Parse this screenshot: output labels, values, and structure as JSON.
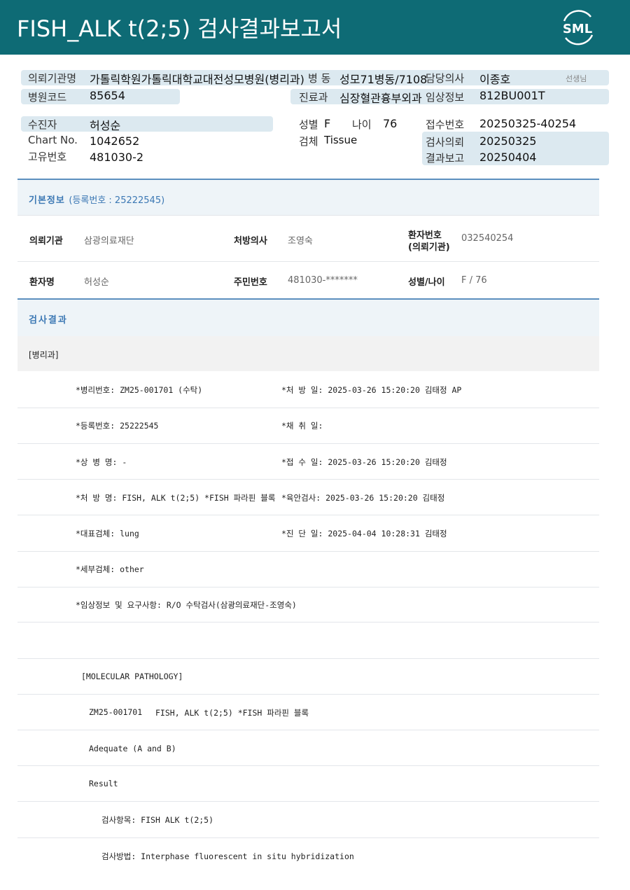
{
  "header": {
    "title": "FISH_ALK t(2;5) 검사결과보고서",
    "logo_text": "SML",
    "band_color": "#0e6b75"
  },
  "info": {
    "institution_label": "의뢰기관명",
    "institution_value": "가톨릭학원가톨릭대학교대전성모병원(병리과)",
    "ward_label": "병  동",
    "ward_value": "성모71병동/7108",
    "doctor_label": "담당의사",
    "doctor_value": "이종호",
    "doctor_suffix": "선생님",
    "hospital_code_label": "병원코드",
    "hospital_code_value": "85654",
    "dept_label": "진료과",
    "dept_value": "심장혈관흉부외과",
    "clinical_label": "임상정보",
    "clinical_value": "812BU001T",
    "patient_label": "수진자",
    "patient_value": "허성순",
    "sex_label": "성별",
    "sex_value": "F",
    "age_label": "나이",
    "age_value": "76",
    "receipt_label": "접수번호",
    "receipt_value": "20250325-40254",
    "chart_label": "Chart No.",
    "chart_value": "1042652",
    "specimen_label": "검체",
    "specimen_value": "Tissue",
    "request_label": "검사의뢰",
    "request_value": "20250325",
    "id_label": "고유번호",
    "id_value": "481030-2",
    "report_label": "결과보고",
    "report_value": "20250404"
  },
  "basic": {
    "title": "기본정보",
    "subtitle": "(등록번호 : 25222545)",
    "fields": {
      "institution_label": "의뢰기관",
      "institution_value": "삼광의료재단",
      "physician_label": "처방의사",
      "physician_value": "조영숙",
      "patient_no_label_1": "환자번호",
      "patient_no_label_2": "(의뢰기관)",
      "patient_no_value": "032540254",
      "name_label": "환자명",
      "name_value": "허성순",
      "rrn_label": "주민번호",
      "rrn_value": "481030-*******",
      "sexage_label": "성별/나이",
      "sexage_value": "F / 76"
    }
  },
  "results": {
    "title": "검사결과",
    "section": "[병리과]",
    "lines": {
      "l1a": "*병리번호: ZM25-001701 (수탁)",
      "l1b": "*처 방 일: 2025-03-26 15:20:20  김태정 AP",
      "l2a": "*등록번호: 25222545",
      "l2b": "*채 취 일:",
      "l3a": "*상 병 명: -",
      "l3b": "*접 수 일: 2025-03-26 15:20:20  김태정",
      "l4a": "*처 방 명: FISH, ALK t(2;5) *FISH 파라핀 블록",
      "l4b": "*육안검사: 2025-03-26 15:20:20  김태정",
      "l5a": "*대표검체: lung",
      "l5b": "*진 단 일: 2025-04-04 10:28:31  김태정",
      "l6a": "*세부검체: other",
      "l7a": "*임상정보 및 요구사항: R/O 수탁검사(삼광의료재단-조영숙)",
      "m1": "[MOLECULAR PATHOLOGY]",
      "m2a": "ZM25-001701",
      "m2b": "FISH, ALK t(2;5) *FISH 파라핀 블록",
      "m3": "Adequate (A and B)",
      "m4": "Result",
      "m5": "검사항목: FISH ALK t(2;5)",
      "m6": "검사방법: Interphase fluorescent in situ hybridization"
    }
  }
}
